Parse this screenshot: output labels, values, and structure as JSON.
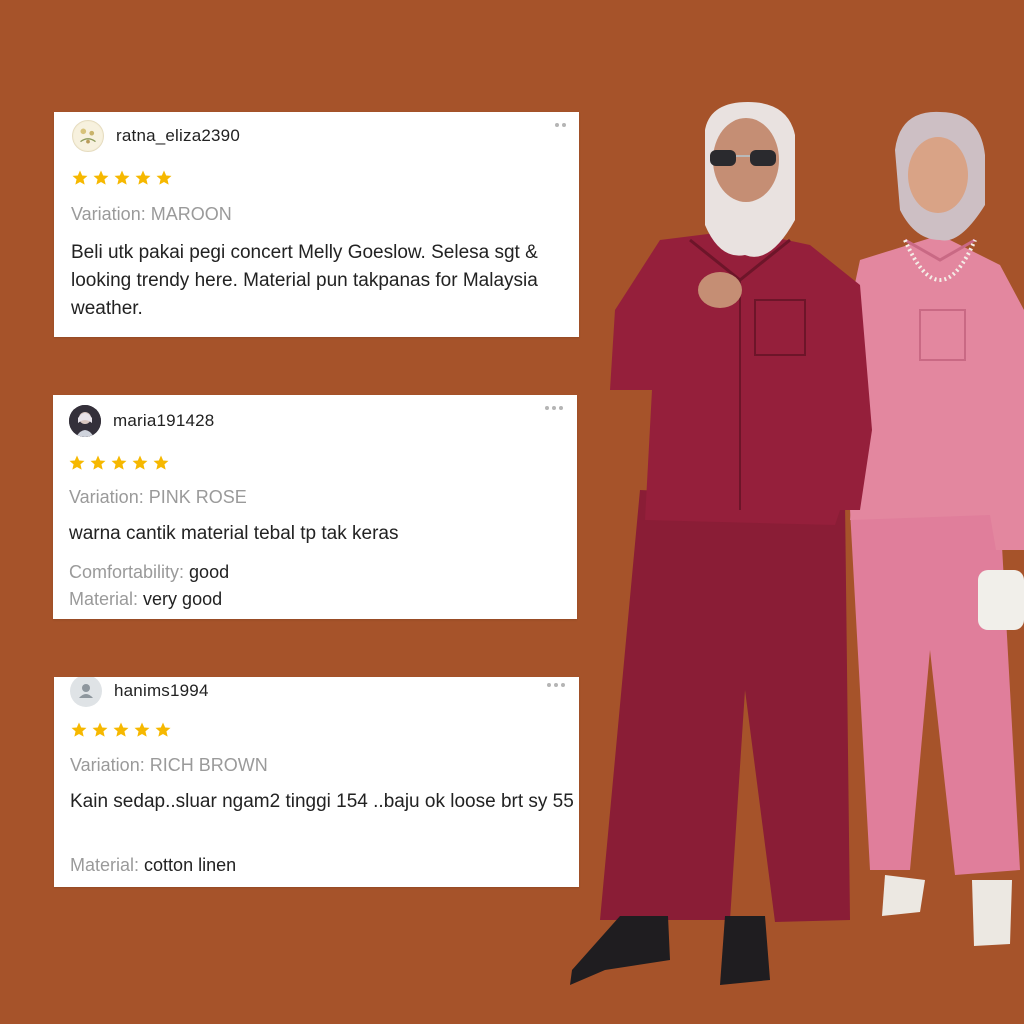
{
  "colors": {
    "background": "#a6532a",
    "star": "#f6b800",
    "maroon": "#8f1f3a",
    "pink_rose": "#e07e9b"
  },
  "reviews": [
    {
      "username": "ratna_eliza2390",
      "avatar_icon": "floral-avatar-icon",
      "rating": 5,
      "variation_label": "Variation:",
      "variation_value": "MAROON",
      "comment": "Beli utk pakai pegi concert Melly Goeslow. Selesa sgt & looking trendy here. Material pun takpanas for Malaysia weather."
    },
    {
      "username": "maria191428",
      "avatar_icon": "photo-avatar-icon",
      "rating": 5,
      "variation_label": "Variation:",
      "variation_value": "PINK ROSE",
      "comment": "warna cantik material tebal tp tak keras",
      "attributes": [
        {
          "key": "Comfortability:",
          "value": "good"
        },
        {
          "key": "Material:",
          "value": "very good"
        }
      ]
    },
    {
      "username": "hanims1994",
      "avatar_icon": "default-user-icon",
      "rating": 5,
      "variation_label": "Variation:",
      "variation_value": "RICH BROWN",
      "comment": "Kain sedap..sluar ngam2 tinggi 154 ..baju ok loose brt sy 55",
      "attributes": [
        {
          "key": "Material:",
          "value": "cotton linen"
        }
      ]
    }
  ]
}
